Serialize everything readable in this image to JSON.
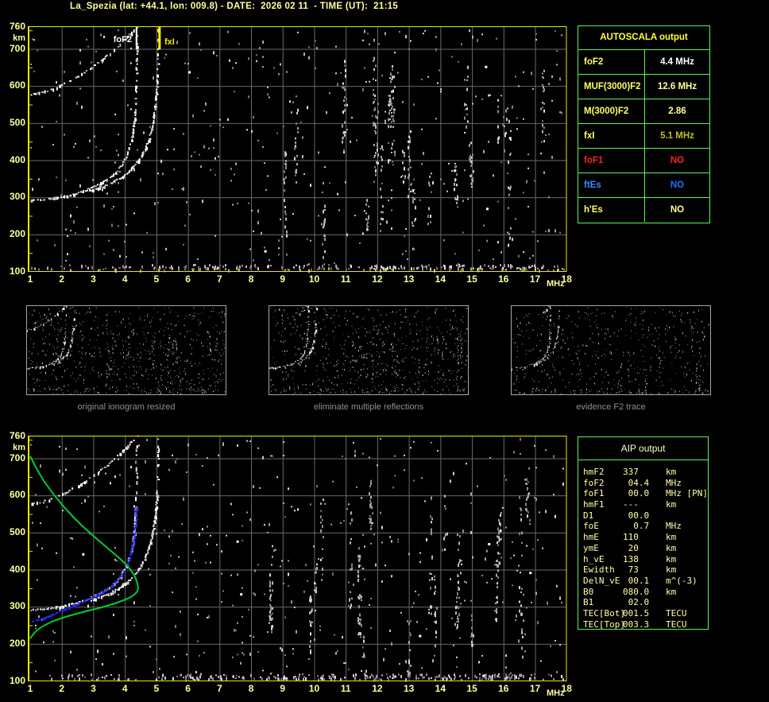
{
  "title": "La_Spezia (lat: +44.1, lon: 009.8) - DATE:  2026 02 11  - TIME (UT):  21:15",
  "colors": {
    "background": "#000000",
    "axis_text": "#ffff9e",
    "plot_border": "#e8e800",
    "grid": "#6a6a6a",
    "table_border": "#5ef05e",
    "trace_white": "#ffffff",
    "profile_green": "#00cc33",
    "restored_blue": "#2626f0",
    "alert_red": "#ff2222",
    "info_blue": "#1f6fff",
    "caption_gray": "#8f8f8f"
  },
  "ionogram_axes": {
    "x_ticks": [
      "1",
      "2",
      "3",
      "4",
      "5",
      "6",
      "7",
      "8",
      "9",
      "10",
      "11",
      "12",
      "13",
      "14",
      "15",
      "16",
      "17",
      "18"
    ],
    "x_unit": "MHz",
    "y_ticks": [
      "760",
      "700",
      "600",
      "500",
      "400",
      "300",
      "200",
      "100"
    ],
    "y_unit": "km"
  },
  "autoscala": {
    "header": "AUTOSCALA output",
    "rows": [
      {
        "label": "foF2",
        "value": "4.4 MHz",
        "label_color": "#ffff66",
        "value_color": "#ffffff"
      },
      {
        "label": "MUF(3000)F2",
        "value": "12.6 MHz",
        "label_color": "#ffff66",
        "value_color": "#ffff9e"
      },
      {
        "label": "M(3000)F2",
        "value": "2.86",
        "label_color": "#ffff66",
        "value_color": "#ffff9e"
      },
      {
        "label": "fxI",
        "value": "5.1 MHz",
        "label_color": "#ffff66",
        "value_color": "#bdbd2f"
      },
      {
        "label": "foF1",
        "value": "NO",
        "label_color": "#ff2222",
        "value_color": "#ff2222"
      },
      {
        "label": "ftEs",
        "value": "NO",
        "label_color": "#3d8bff",
        "value_color": "#1f6fff"
      },
      {
        "label": "h'Es",
        "value": "NO",
        "label_color": "#ffff66",
        "value_color": "#ffff9e"
      }
    ]
  },
  "aip": {
    "header": "AIP output",
    "rows": [
      {
        "label": "hmF2",
        "value": "337",
        "unit": "km"
      },
      {
        "label": "foF2",
        "value": " 04.4",
        "unit": "MHz"
      },
      {
        "label": "foF1",
        "value": " 00.0",
        "unit": "MHz [PN]"
      },
      {
        "label": "hmF1",
        "value": "---",
        "unit": "km"
      },
      {
        "label": "D1",
        "value": " 00.0",
        "unit": ""
      },
      {
        "label": "foE",
        "value": "  0.7",
        "unit": "MHz"
      },
      {
        "label": "hmE",
        "value": "110",
        "unit": "km"
      },
      {
        "label": "ymE",
        "value": " 20",
        "unit": "km"
      },
      {
        "label": "h_vE",
        "value": "138",
        "unit": "km"
      },
      {
        "label": "Ewidth",
        "value": " 73",
        "unit": "km"
      },
      {
        "label": "DelN_vE",
        "value": " 00.1",
        "unit": "m^(-3)"
      },
      {
        "label": "B0",
        "value": "080.0",
        "unit": "km"
      },
      {
        "label": "B1",
        "value": " 02.0",
        "unit": ""
      },
      {
        "label": "TEC[Bot]",
        "value": "001.5",
        "unit": "TECU"
      },
      {
        "label": "TEC[Top]",
        "value": "003.3",
        "unit": "TECU"
      }
    ]
  },
  "thumbnails": [
    {
      "caption": "original ionogram resized"
    },
    {
      "caption": "eliminate multiple reflections"
    },
    {
      "caption": "evidence F2 trace"
    }
  ],
  "chart_data": {
    "type": "scatter",
    "title": "Ionogram with AUTOSCALA automatic scaling",
    "x_axis": {
      "label": "MHz",
      "range": [
        1,
        18
      ]
    },
    "y_axis": {
      "label": "km",
      "range": [
        100,
        760
      ]
    },
    "markers": [
      {
        "label": "foF2",
        "freq": 4.37,
        "color": "#ffffff"
      },
      {
        "label": "fxI",
        "freq": 5.1,
        "color": "#ffee00"
      }
    ],
    "series": [
      {
        "name": "F2-ordinary-trace",
        "color": "#ffffff",
        "plots": [
          "top",
          "bottom",
          "thumbs"
        ],
        "points": [
          [
            1.05,
            291
          ],
          [
            1.35,
            293
          ],
          [
            1.65,
            296
          ],
          [
            1.95,
            300
          ],
          [
            2.25,
            305
          ],
          [
            2.55,
            312
          ],
          [
            2.85,
            321
          ],
          [
            3.15,
            333
          ],
          [
            3.45,
            347
          ],
          [
            3.7,
            364
          ],
          [
            3.9,
            385
          ],
          [
            4.05,
            409
          ],
          [
            4.17,
            437
          ],
          [
            4.26,
            470
          ],
          [
            4.31,
            505
          ],
          [
            4.34,
            545
          ],
          [
            4.36,
            585
          ],
          [
            4.37,
            625
          ],
          [
            4.38,
            670
          ],
          [
            4.38,
            715
          ],
          [
            4.38,
            758
          ]
        ]
      },
      {
        "name": "F2-extraordinary-trace",
        "color": "#ffffff",
        "plots": [
          "top",
          "bottom",
          "thumbs"
        ],
        "points": [
          [
            2.95,
            317
          ],
          [
            3.25,
            326
          ],
          [
            3.55,
            337
          ],
          [
            3.85,
            351
          ],
          [
            4.1,
            367
          ],
          [
            4.3,
            384
          ],
          [
            4.48,
            404
          ],
          [
            4.63,
            427
          ],
          [
            4.76,
            454
          ],
          [
            4.86,
            485
          ],
          [
            4.93,
            520
          ],
          [
            4.98,
            556
          ],
          [
            5.02,
            592
          ],
          [
            5.04,
            630
          ],
          [
            5.06,
            672
          ],
          [
            5.07,
            715
          ],
          [
            5.07,
            755
          ]
        ]
      },
      {
        "name": "second-hop-trace",
        "color": "#ffffff",
        "plots": [
          "top",
          "bottom",
          "thumb1-full"
        ],
        "points": [
          [
            1.05,
            577
          ],
          [
            1.3,
            581
          ],
          [
            1.6,
            588
          ],
          [
            1.9,
            598
          ],
          [
            2.2,
            610
          ],
          [
            2.5,
            624
          ],
          [
            2.8,
            640
          ],
          [
            3.1,
            658
          ],
          [
            3.4,
            678
          ],
          [
            3.7,
            700
          ],
          [
            3.95,
            720
          ],
          [
            4.15,
            738
          ],
          [
            4.32,
            753
          ],
          [
            4.45,
            762
          ]
        ]
      },
      {
        "name": "electron-density-profile",
        "color": "#00cc33",
        "plots": [
          "bottom"
        ],
        "points": [
          [
            1.0,
            706
          ],
          [
            1.2,
            672
          ],
          [
            1.45,
            637
          ],
          [
            1.75,
            602
          ],
          [
            2.05,
            571
          ],
          [
            2.35,
            543
          ],
          [
            2.65,
            518
          ],
          [
            2.95,
            495
          ],
          [
            3.25,
            473
          ],
          [
            3.55,
            451
          ],
          [
            3.8,
            433
          ],
          [
            4.0,
            417
          ],
          [
            4.15,
            403
          ],
          [
            4.27,
            389
          ],
          [
            4.35,
            375
          ],
          [
            4.4,
            362
          ],
          [
            4.42,
            352
          ],
          [
            4.4,
            342
          ],
          [
            4.32,
            334
          ],
          [
            4.18,
            326
          ],
          [
            3.98,
            318
          ],
          [
            3.72,
            310
          ],
          [
            3.42,
            302
          ],
          [
            3.12,
            295
          ],
          [
            2.82,
            289
          ],
          [
            2.52,
            282
          ],
          [
            2.22,
            275
          ],
          [
            1.92,
            267
          ],
          [
            1.66,
            259
          ],
          [
            1.45,
            250
          ],
          [
            1.28,
            241
          ],
          [
            1.15,
            231
          ],
          [
            1.06,
            222
          ],
          [
            1.0,
            214
          ]
        ]
      },
      {
        "name": "restored-o-trace",
        "color": "#2626f0",
        "plots": [
          "bottom"
        ],
        "points": [
          [
            1.02,
            258
          ],
          [
            1.25,
            265
          ],
          [
            1.5,
            273
          ],
          [
            1.75,
            282
          ],
          [
            2.0,
            291
          ],
          [
            2.25,
            300
          ],
          [
            2.5,
            308
          ],
          [
            2.75,
            317
          ],
          [
            3.0,
            327
          ],
          [
            3.25,
            338
          ],
          [
            3.5,
            352
          ],
          [
            3.72,
            368
          ],
          [
            3.9,
            387
          ],
          [
            4.05,
            409
          ],
          [
            4.16,
            434
          ],
          [
            4.24,
            463
          ],
          [
            4.3,
            495
          ],
          [
            4.33,
            527
          ],
          [
            4.35,
            555
          ],
          [
            4.36,
            575
          ]
        ]
      }
    ]
  }
}
